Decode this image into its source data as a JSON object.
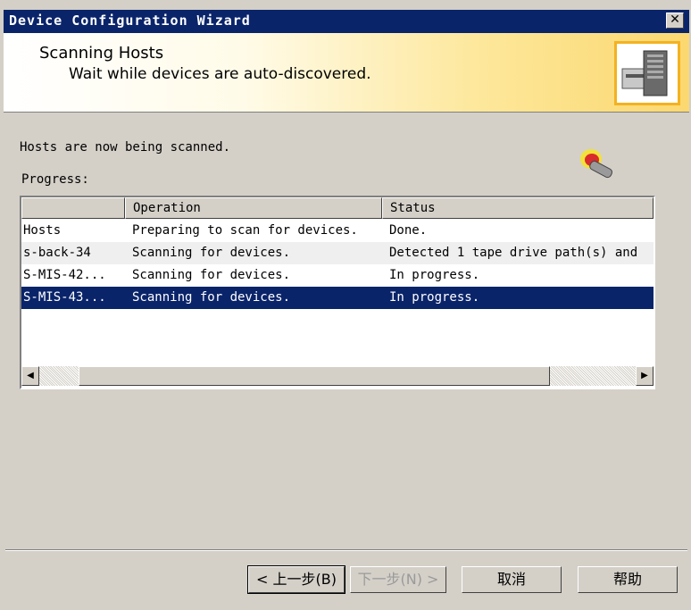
{
  "window": {
    "title": "Device Configuration Wizard",
    "close_glyph": "✕"
  },
  "header": {
    "title": "Scanning Hosts",
    "subtitle": "Wait while devices are auto-discovered.",
    "icon": "server-tape-icon"
  },
  "status_text": "Hosts are now being scanned.",
  "progress_label": "Progress:",
  "table": {
    "columns": [
      "",
      "Operation",
      "Status"
    ],
    "rows": [
      {
        "host": " Hosts",
        "operation": "Preparing to scan for devices.",
        "status": "Done."
      },
      {
        "host": "s-back-34",
        "operation": "Scanning for devices.",
        "status": "Detected 1 tape drive path(s) and"
      },
      {
        "host": "S-MIS-42...",
        "operation": "Scanning for devices.",
        "status": "In progress."
      },
      {
        "host": "S-MIS-43...",
        "operation": "Scanning for devices.",
        "status": "In progress."
      }
    ],
    "selected_row": 3
  },
  "scrollbar": {
    "left_arrow": "◀",
    "right_arrow": "▶"
  },
  "buttons": {
    "back": "< 上一步(B)",
    "next": "下一步(N) >",
    "cancel": "取消",
    "help": "帮助"
  },
  "colors": {
    "titlebar": "#0a246a",
    "selection": "#0a246a",
    "header_accent": "#f4b220"
  }
}
